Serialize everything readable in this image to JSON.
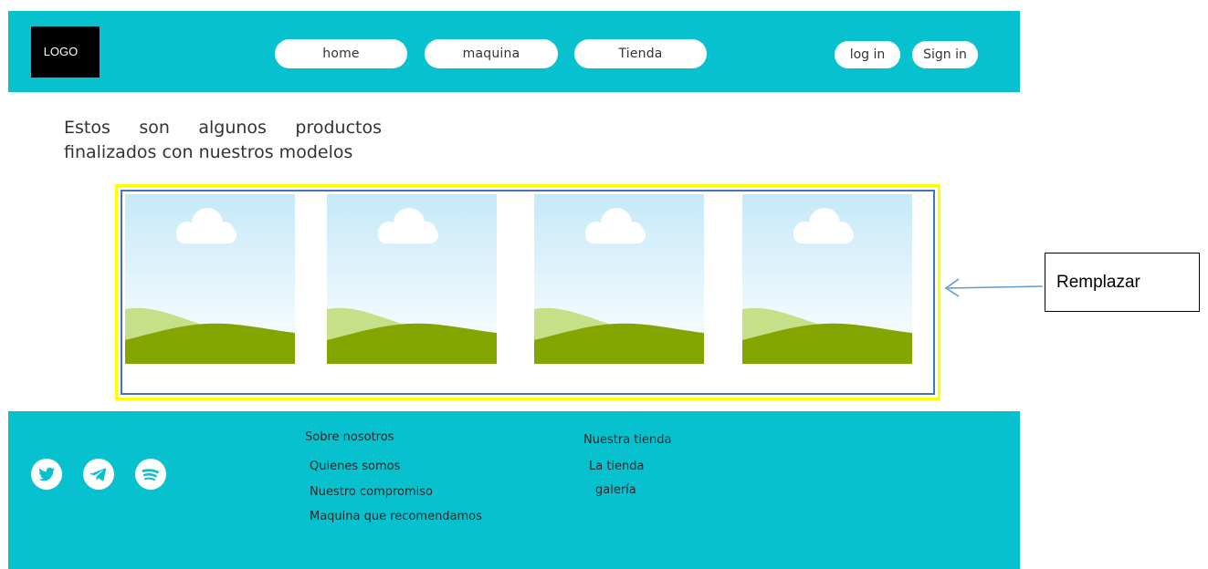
{
  "header": {
    "logo_text": "LOGO",
    "nav": [
      "home",
      "maquina",
      "Tienda"
    ],
    "login_label": "log in",
    "signin_label": "Sign in"
  },
  "main": {
    "intro_line1": "Estos son algunos productos",
    "intro_line2": "finalizados con nuestros modelos",
    "gallery_count": 4
  },
  "annotation": {
    "label": "Remplazar"
  },
  "footer": {
    "social_icons": [
      "twitter-icon",
      "telegram-icon",
      "spotify-icon"
    ],
    "col1_title": "Sobre nosotros",
    "col1_links": [
      "Quienes somos",
      "Nuestro compromiso",
      "Maquina que recomendamos"
    ],
    "col2_title": "Nuestra tienda",
    "col2_links": [
      "La tienda",
      "galería"
    ]
  },
  "colors": {
    "brand": "#07c1cf",
    "frame_outer": "#ffff00",
    "frame_inner": "#4472c4",
    "hill_dark": "#84a500",
    "hill_light": "#c6e08a",
    "sky_top": "#c6e9f9"
  }
}
